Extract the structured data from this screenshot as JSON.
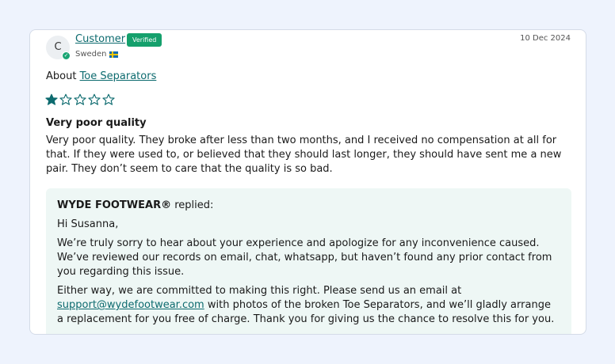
{
  "review": {
    "avatar_initial": "C",
    "reviewer_name": "Customer",
    "verified_label": "Verified",
    "country": "Sweden",
    "date": "10 Dec 2024",
    "about_prefix": "About",
    "product_link": "Toe Separators",
    "rating": 1,
    "rating_max": 5,
    "star_color": "#0d6b6f",
    "title": "Very poor quality",
    "text": "Very poor quality. They broke after less than two months, and I received no compensation at all for that. If they were used to, or believed that they should last longer, they should have sent me a new pair. They don’t seem to care that the quality is so bad."
  },
  "reply": {
    "brand": "WYDE FOOTWEAR®",
    "replied_label": "replied:",
    "greeting": "Hi Susanna,",
    "paragraph1": "We’re truly sorry to hear about your experience and apologize for any inconvenience caused. We’ve reviewed our records on email, chat, whatsapp, but haven’t found any prior contact from you regarding this issue.",
    "paragraph2_prefix": "Either way, we are committed to making this right. Please send us an email at",
    "email": "support@wydefootwear.com",
    "paragraph2_suffix": "with photos of the broken Toe Separators, and we’ll gladly arrange a replacement for you free of charge. Thank you for giving us the chance to resolve this for you."
  }
}
